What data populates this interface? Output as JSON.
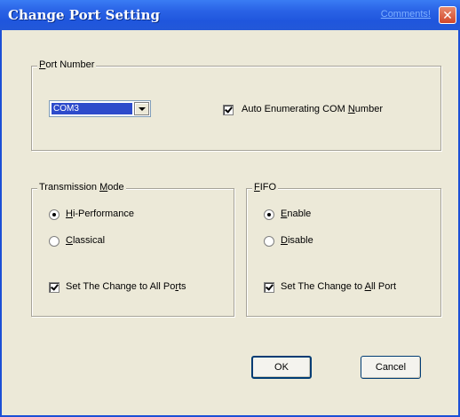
{
  "window": {
    "title": "Change Port Setting",
    "comments_link": "Comments!",
    "close_icon": "close-icon",
    "colors": {
      "titlebar": "#2a63e6",
      "face": "#ece9d8",
      "selection": "#2d4bcb"
    }
  },
  "port_number": {
    "legend_a": "P",
    "legend_b": "ort Number",
    "selected_port": "COM3",
    "auto_enum": {
      "label_a": "Auto Enumerating COM ",
      "label_b": "N",
      "label_c": "umber",
      "checked": true
    }
  },
  "transmission_mode": {
    "legend_a": "Transmission ",
    "legend_b": "M",
    "legend_c": "ode",
    "options": [
      {
        "label_a": "",
        "label_b": "H",
        "label_c": "i-Performance",
        "selected": true
      },
      {
        "label_a": "",
        "label_b": "C",
        "label_c": "lassical",
        "selected": false
      }
    ],
    "apply_all": {
      "label_a": "Set The Change to All Po",
      "label_b": "r",
      "label_c": "ts",
      "checked": true
    }
  },
  "fifo": {
    "legend_a": "",
    "legend_b": "F",
    "legend_c": "IFO",
    "options": [
      {
        "label_a": "",
        "label_b": "E",
        "label_c": "nable",
        "selected": true
      },
      {
        "label_a": "",
        "label_b": "D",
        "label_c": "isable",
        "selected": false
      }
    ],
    "apply_all": {
      "label_a": "Set The Change to ",
      "label_b": "A",
      "label_c": "ll Port",
      "checked": true
    }
  },
  "buttons": {
    "ok": "OK",
    "cancel": "Cancel"
  }
}
